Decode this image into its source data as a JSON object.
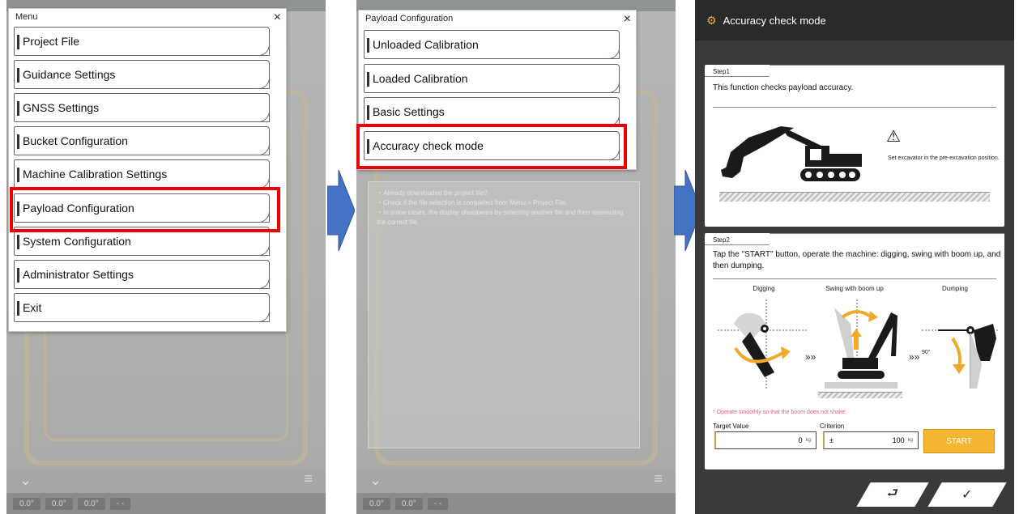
{
  "panel1": {
    "title": "Menu",
    "close": "×",
    "items": [
      "Project File",
      "Guidance Settings",
      "GNSS Settings",
      "Bucket Configuration",
      "Machine Calibration Settings",
      "Payload Configuration",
      "System Configuration",
      "Administrator Settings",
      "Exit"
    ],
    "highlighted": "Payload Configuration",
    "bottom_values": [
      "0.0°",
      "0.0°",
      "0.0°",
      "- -"
    ]
  },
  "panel2": {
    "title": "Payload Configuration",
    "close": "×",
    "items": [
      "Unloaded Calibration",
      "Loaded Calibration",
      "Basic Settings",
      "Accuracy check mode"
    ],
    "highlighted": "Accuracy check mode",
    "hints": [
      "・Already downloaded the project file?",
      "・Check if the file selection is completed from Menu > Project File.",
      "・In some cases, the display disappears by selecting another file and then reselecting the correct file."
    ],
    "bottom_values": [
      "0.0°",
      "0.0°",
      "- -"
    ]
  },
  "panel3": {
    "header_title": "Accuracy check mode",
    "step1": {
      "label": "Step1",
      "text": "This function checks payload accuracy.",
      "warning_icon": "⚠",
      "note": "Set excavator in the pre-excavation position."
    },
    "step2": {
      "label": "Step2",
      "text": "Tap the \"START\" button, operate the machine: digging, swing with boom up, and then dumping.",
      "captions": [
        "Digging",
        "Swing with boom up",
        "Dumping"
      ],
      "chevrons": "»»",
      "angle": "90°",
      "warning": "* Operate smoothly so that the boom does not shake.",
      "target_label": "Target Value",
      "target_value": "0",
      "target_unit": "kg",
      "criterion_label": "Criterion",
      "criterion_prefix": "±",
      "criterion_value": "100",
      "criterion_unit": "kg",
      "start_label": "START"
    },
    "footer": {
      "back": "⮐",
      "ok": "✓"
    }
  },
  "colors": {
    "highlight": "#ee0000",
    "arrow": "#4472c4",
    "accent": "#f5b731",
    "header": "#2a2a2a"
  }
}
